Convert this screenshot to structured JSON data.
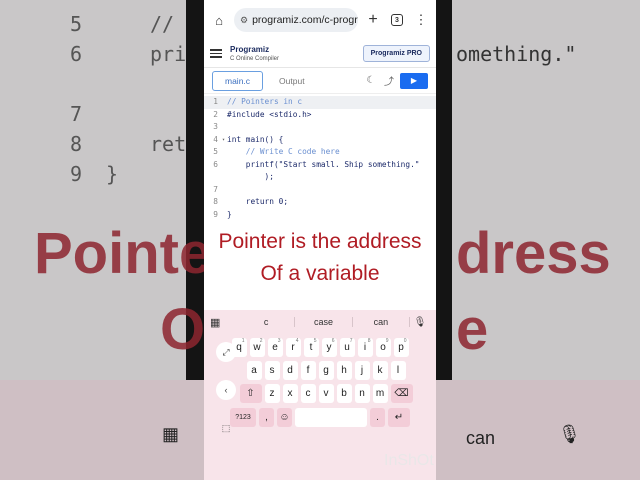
{
  "background": {
    "code_lines": [
      {
        "ln": "5",
        "text": "//"
      },
      {
        "ln": "6",
        "text": "pri"
      },
      {
        "ln": "7",
        "text": ""
      },
      {
        "ln": "8",
        "text": "ret"
      },
      {
        "ln": "9",
        "text": "}"
      }
    ],
    "right_snippet": "omething.\"",
    "big_text_left": "Pointe",
    "big_text_left2": "O",
    "big_text_right": "dress",
    "big_text_right2": "e",
    "bottom_can": "can"
  },
  "browser": {
    "url": "programiz.com/c-progra",
    "tab_count": "3"
  },
  "site": {
    "logo": "Programiz",
    "subtitle": "C Online Compiler",
    "pro_button": "Programiz PRO"
  },
  "tabs": {
    "main": "main.c",
    "output": "Output"
  },
  "code": [
    {
      "ln": "1",
      "fold": "",
      "text": "// Pointers in c",
      "type": "cmt"
    },
    {
      "ln": "2",
      "fold": "",
      "text": "#include <stdio.h>",
      "type": "code"
    },
    {
      "ln": "3",
      "fold": "",
      "text": "",
      "type": "code"
    },
    {
      "ln": "4",
      "fold": "▾",
      "text": "int main() {",
      "type": "code"
    },
    {
      "ln": "5",
      "fold": "",
      "text": "    // Write C code here",
      "type": "cmt"
    },
    {
      "ln": "6",
      "fold": "",
      "text": "    printf(\"Start small. Ship something.\"",
      "type": "code"
    },
    {
      "ln": "",
      "fold": "",
      "text": "        );",
      "type": "code"
    },
    {
      "ln": "7",
      "fold": "",
      "text": "",
      "type": "code"
    },
    {
      "ln": "8",
      "fold": "",
      "text": "    return 0;",
      "type": "code"
    },
    {
      "ln": "9",
      "fold": "",
      "text": "}",
      "type": "code"
    }
  ],
  "overlay": {
    "line1": "Pointer is the address",
    "line2": "Of a variable"
  },
  "keyboard": {
    "suggestions": [
      "c",
      "case",
      "can"
    ],
    "row1": [
      {
        "k": "q",
        "s": "1"
      },
      {
        "k": "w",
        "s": "2"
      },
      {
        "k": "e",
        "s": "3"
      },
      {
        "k": "r",
        "s": "4"
      },
      {
        "k": "t",
        "s": "5"
      },
      {
        "k": "y",
        "s": "6"
      },
      {
        "k": "u",
        "s": "7"
      },
      {
        "k": "i",
        "s": "8"
      },
      {
        "k": "o",
        "s": "9"
      },
      {
        "k": "p",
        "s": "0"
      }
    ],
    "row2": [
      "a",
      "s",
      "d",
      "f",
      "g",
      "h",
      "j",
      "k",
      "l"
    ],
    "row3": [
      "z",
      "x",
      "c",
      "v",
      "b",
      "n",
      "m"
    ],
    "symbols_key": "?123",
    "comma": ",",
    "period": "."
  },
  "watermark": "InShOt"
}
